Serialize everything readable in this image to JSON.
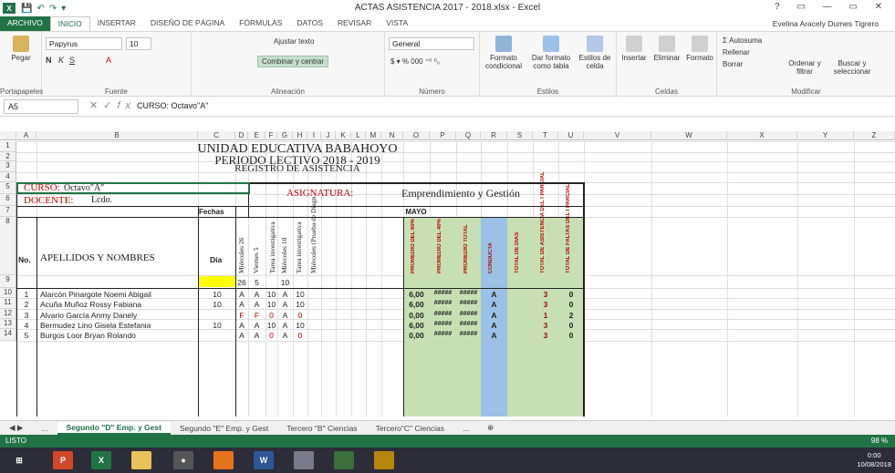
{
  "window": {
    "title": "ACTAS ASISTENCIA 2017 - 2018.xlsx - Excel",
    "controls": "? ▭ — ▭ ✕"
  },
  "tabs": [
    "ARCHIVO",
    "INICIO",
    "INSERTAR",
    "DISEÑO DE PÁGINA",
    "FÓRMULAS",
    "DATOS",
    "REVISAR",
    "VISTA"
  ],
  "user": "Evelina Aracely Dumes Tigrero",
  "ribbon": {
    "paste": "Pegar",
    "clipboard": "Portapapeles",
    "font_name": "Papyrus",
    "font_size": "10",
    "font_group": "Fuente",
    "wrap_text": "Ajustar texto",
    "merge_center": "Combinar y centrar",
    "alignment": "Alineación",
    "number_format": "General",
    "number_group": "Número",
    "number_symbols": "$ ▾ % 000 ⁺⁰ ⁰₀",
    "cond_format": "Formato condicional",
    "table_format": "Dar formato como tabla",
    "cell_styles": "Estilos de celda",
    "styles": "Estilos",
    "insert": "Insertar",
    "delete": "Eliminar",
    "format": "Formato",
    "cells": "Celdas",
    "autosum": "Autosuma",
    "fill": "Rellenar",
    "clear": "Borrar",
    "sort": "Ordenar y filtrar",
    "find": "Buscar y seleccionar",
    "modify": "Modificar"
  },
  "formula_bar": {
    "name_box": "A5",
    "fx": "fx",
    "value": "CURSO:    Octavo\"A\""
  },
  "columns": [
    "A",
    "B",
    "C",
    "D",
    "E",
    "F",
    "G",
    "H",
    "I",
    "J",
    "K",
    "L",
    "M",
    "N",
    "O",
    "P",
    "Q",
    "R",
    "S",
    "T",
    "U",
    "V",
    "W",
    "X",
    "Y",
    "Z"
  ],
  "rows": [
    "1",
    "2",
    "3",
    "4",
    "5",
    "6",
    "7",
    "8",
    "9",
    "10",
    "11",
    "12",
    "13",
    "14"
  ],
  "sheet": {
    "title1": "UNIDAD EDUCATIVA BABAHOYO",
    "title2": "PERIODO LECTIVO 2018 - 2019",
    "title3": "REGISTRO DE ASISTENCIA",
    "curso_label": "CURSO:",
    "curso_value": "Octavo\"A\"",
    "docente_label": "DOCENTE:",
    "docente_value": "Lcdo.",
    "asignatura_label": "ASIGNATURA:",
    "asignatura_value": "Emprendimiento y Gestión",
    "fechas": "Fechas",
    "mes": "MAYO",
    "no": "No.",
    "apellidos": "APELLIDOS Y NOMBRES",
    "dia": "Día",
    "date_headers": [
      "Miércoles 26",
      "Viernes 5",
      "Tarea investigativa",
      "Miércoles 10",
      "Tarea investigativa",
      "Miércoles (Prueba de Diagn"
    ],
    "day_numbers": [
      "26",
      "5",
      "",
      "10"
    ],
    "summary_headers": [
      "PROMEDIO DEL 60%",
      "PROMEDIO DEL 40%",
      "PROMEDIO TOTAL",
      "CONDUCTA",
      "TOTAL DE DIAS",
      "TOTAL DE ASISTENCIA DEL I PARCIAL",
      "TOTAL DE FALTAS DEL I PARCIAL"
    ],
    "students": [
      {
        "n": "1",
        "name": "Alarcón Pinargote Noemi Abigail",
        "dia": "10",
        "marks": [
          "A",
          "A",
          "10",
          "A",
          "10"
        ],
        "p60": "6,00",
        "p40": "#####",
        "pt": "#####",
        "cond": "A",
        "asis": "3",
        "faltas": "0"
      },
      {
        "n": "2",
        "name": "Acuña Muñoz Rossy Fabiana",
        "dia": "10",
        "marks": [
          "A",
          "A",
          "10",
          "A",
          "10"
        ],
        "p60": "6,00",
        "p40": "#####",
        "pt": "#####",
        "cond": "A",
        "asis": "3",
        "faltas": "0"
      },
      {
        "n": "3",
        "name": "Alvario García Anmy Danely",
        "dia": "",
        "marks": [
          "F",
          "F",
          "0",
          "A",
          "0"
        ],
        "p60": "0,00",
        "p40": "#####",
        "pt": "#####",
        "cond": "A",
        "asis": "1",
        "faltas": "2"
      },
      {
        "n": "4",
        "name": "Bermudez Lino Gisela Estefania",
        "dia": "10",
        "marks": [
          "A",
          "A",
          "10",
          "A",
          "10"
        ],
        "p60": "6,00",
        "p40": "#####",
        "pt": "#####",
        "cond": "A",
        "asis": "3",
        "faltas": "0"
      },
      {
        "n": "5",
        "name": "Burgos Loor Bryan Rolando",
        "dia": "",
        "marks": [
          "A",
          "A",
          "0",
          "A",
          "0"
        ],
        "p60": "0,00",
        "p40": "#####",
        "pt": "#####",
        "cond": "A",
        "asis": "3",
        "faltas": "0"
      }
    ]
  },
  "sheet_tabs": [
    "...",
    "Segundo \"D\" Emp. y Gest",
    "Segundo \"E\" Emp. y Gest",
    "Tercero \"B\" Ciencias",
    "Tercero\"C\" Ciencias",
    "..."
  ],
  "status": {
    "ready": "LISTO",
    "zoom": "98 %"
  },
  "clock": {
    "time": "0:00",
    "date": "10/08/2018"
  },
  "colors": {
    "excel_green": "#217346",
    "header_red": "#c00000",
    "summary_green": "#c6e0b4",
    "summary_blue": "#9bc2e6",
    "selection_yellow": "#ffff00"
  }
}
